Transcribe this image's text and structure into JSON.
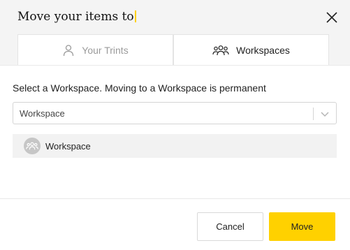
{
  "dialog": {
    "title": "Move your items to",
    "close_icon": "close-icon"
  },
  "tabs": [
    {
      "label": "Your Trints",
      "icon": "user-icon",
      "active": false
    },
    {
      "label": "Workspaces",
      "icon": "group-icon",
      "active": true
    }
  ],
  "instruction": "Select a Workspace. Moving to a Workspace is permanent",
  "select": {
    "value": "Workspace",
    "icon": "chevron-down-icon"
  },
  "workspace_list": [
    {
      "label": "Workspace",
      "icon": "group-avatar-icon"
    }
  ],
  "buttons": {
    "cancel": "Cancel",
    "move": "Move"
  },
  "colors": {
    "accent": "#ffd100",
    "header_bg": "#f4f4f4"
  }
}
